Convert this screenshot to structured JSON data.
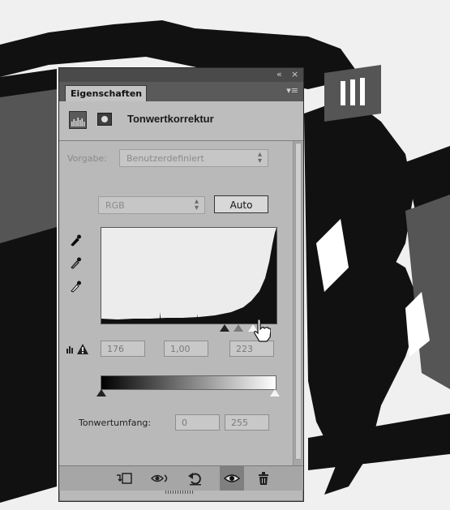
{
  "panel": {
    "collapse_label": "«",
    "close_label": "×",
    "tab_label": "Eigenschaften",
    "menu_icon": "▾≡",
    "title": "Tonwertkorrektur"
  },
  "preset": {
    "label": "Vorgabe:",
    "value": "Benutzerdefiniert"
  },
  "channel": {
    "value": "RGB",
    "auto_label": "Auto"
  },
  "input_levels": {
    "black": "176",
    "gamma": "1,00",
    "white": "223"
  },
  "output_levels": {
    "label": "Tonwertumfang:",
    "black": "0",
    "white": "255"
  },
  "footer_icons": [
    "clip-to-layer-icon",
    "view-previous-icon",
    "reset-icon",
    "visibility-icon",
    "trash-icon"
  ],
  "colors": {
    "panel_bg": "#b9b9b9",
    "tab_bar": "#5a5a5a",
    "histogram_bg": "#ececec"
  }
}
